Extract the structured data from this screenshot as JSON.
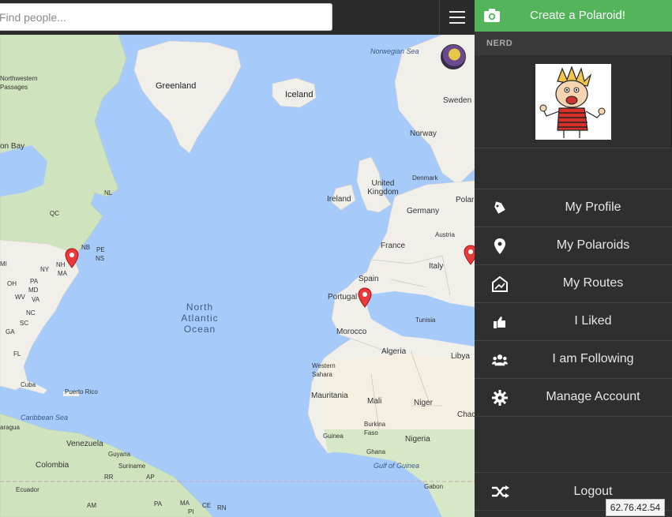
{
  "search": {
    "placeholder": "Find people..."
  },
  "sidebar": {
    "create_label": "Create a Polaroid!",
    "username": "NERD",
    "menu": [
      {
        "label": "My Profile",
        "icon": "tag-icon"
      },
      {
        "label": "My Polaroids",
        "icon": "map-marker-icon"
      },
      {
        "label": "My Routes",
        "icon": "map-route-icon"
      },
      {
        "label": "I Liked",
        "icon": "thumbs-up-icon"
      },
      {
        "label": "I am Following",
        "icon": "users-icon"
      },
      {
        "label": "Manage Account",
        "icon": "gear-icon"
      }
    ],
    "logout_label": "Logout"
  },
  "ip_address": "62.76.42.54",
  "map": {
    "labels": {
      "norwegian_sea": "Norwegian Sea",
      "northwestern_passages": "Northwestern Passages",
      "greenland": "Greenland",
      "iceland": "Iceland",
      "sweden": "Sweden",
      "norway": "Norway",
      "hudson_bay": "on Bay",
      "united_kingdom": "United Kingdom",
      "denmark": "Denmark",
      "ireland": "Ireland",
      "germany": "Germany",
      "poland": "Polar",
      "austria": "Austria",
      "france": "France",
      "italy": "Italy",
      "spain": "Spain",
      "portugal": "Portugal",
      "tunisia": "Tunisia",
      "morocco": "Morocco",
      "algeria": "Algeria",
      "libya": "Libya",
      "western_sahara": "Western Sahara",
      "mauritania": "Mauritania",
      "mali": "Mali",
      "niger": "Niger",
      "chad": "Chac",
      "guinea": "Guinea",
      "burkina_faso": "Burkina Faso",
      "nigeria": "Nigeria",
      "ghana": "Ghana",
      "gulf_of_guinea": "Gulf of Guinea",
      "gabon": "Gabon",
      "north_atlantic_ocean": "North Atlantic Ocean",
      "nl": "NL",
      "qc": "QC",
      "nb": "NB",
      "pe": "PE",
      "ns": "NS",
      "nh": "NH",
      "ma": "MA",
      "ny": "NY",
      "mi": "MI",
      "oh": "OH",
      "pa": "PA",
      "md": "MD",
      "wv": "WV",
      "va": "VA",
      "nc": "NC",
      "sc": "SC",
      "ga": "GA",
      "fl": "FL",
      "cuba": "Cuba",
      "puerto_rico": "Puerto Rico",
      "caribbean_sea": "Caribbean Sea",
      "nicaragua": "aragua",
      "venezuela": "Venezuela",
      "guyana": "Guyana",
      "suriname": "Suriname",
      "colombia": "Colombia",
      "rr": "RR",
      "ap": "AP",
      "ecuador": "Ecuador",
      "am": "AM",
      "pa_br": "PA",
      "ma_br": "MA",
      "ce": "CE",
      "rn": "RN",
      "pi": "PI"
    }
  }
}
